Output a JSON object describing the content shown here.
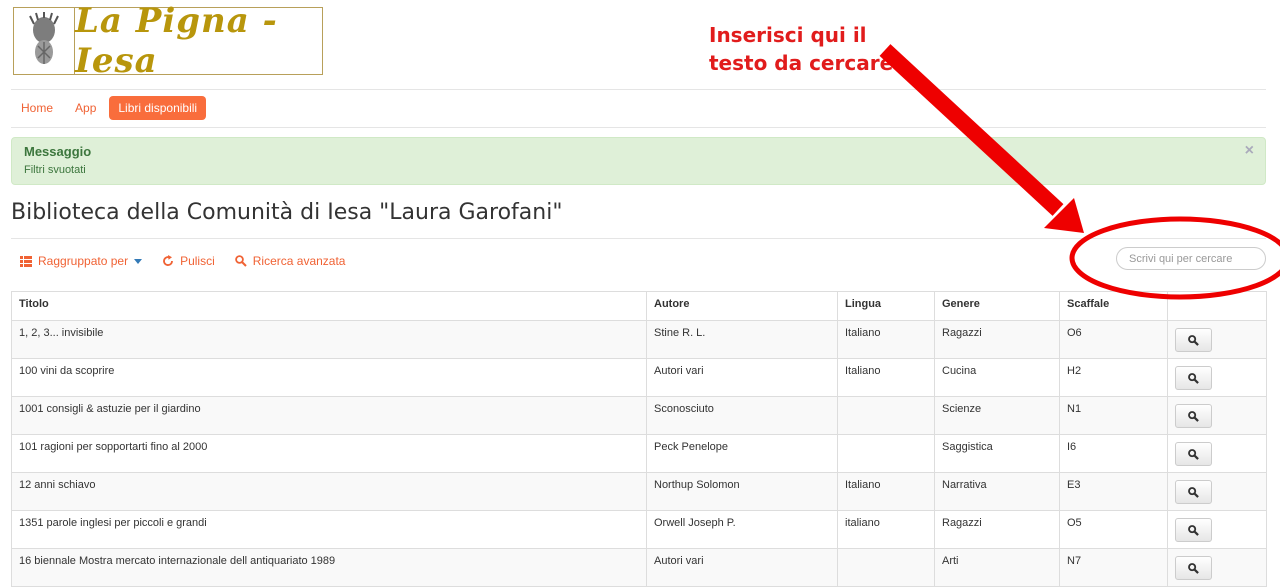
{
  "logo": {
    "text": "La Pigna - Iesa"
  },
  "annotation": {
    "line1": "Inserisci qui il",
    "line2": "testo da cercare"
  },
  "nav": {
    "items": [
      {
        "label": "Home",
        "active": false
      },
      {
        "label": "App",
        "active": false
      },
      {
        "label": "Libri disponibili",
        "active": true
      }
    ]
  },
  "alert": {
    "title": "Messaggio",
    "message": "Filtri svuotati",
    "close": "×"
  },
  "page": {
    "title": "Biblioteca della Comunità di Iesa \"Laura Garofani\""
  },
  "toolbar": {
    "group_by": "Raggruppato per",
    "clear": "Pulisci",
    "advanced": "Ricerca avanzata"
  },
  "search": {
    "placeholder": "Scrivi qui per cercare"
  },
  "table": {
    "columns": [
      "Titolo",
      "Autore",
      "Lingua",
      "Genere",
      "Scaffale",
      ""
    ],
    "rows": [
      [
        "1, 2, 3... invisibile",
        "Stine R. L.",
        "Italiano",
        "Ragazzi",
        "O6"
      ],
      [
        "100 vini da scoprire",
        "Autori vari",
        "Italiano",
        "Cucina",
        "H2"
      ],
      [
        "1001 consigli & astuzie per il giardino",
        "Sconosciuto",
        "",
        "Scienze",
        "N1"
      ],
      [
        "101 ragioni per sopportarti fino al 2000",
        "Peck Penelope",
        "",
        "Saggistica",
        "I6"
      ],
      [
        "12 anni schiavo",
        "Northup Solomon",
        "Italiano",
        "Narrativa",
        "E3"
      ],
      [
        "1351 parole inglesi per piccoli e grandi",
        "Orwell Joseph P.",
        "italiano",
        "Ragazzi",
        "O5"
      ],
      [
        "16 biennale Mostra mercato internazionale dell antiquariato 1989",
        "Autori vari",
        "",
        "Arti",
        "N7"
      ]
    ]
  },
  "colors": {
    "accent": "#f96d3c",
    "annotation": "#e11c1c",
    "logo_gold": "#b8960c",
    "alert_bg": "#dff0d8"
  }
}
